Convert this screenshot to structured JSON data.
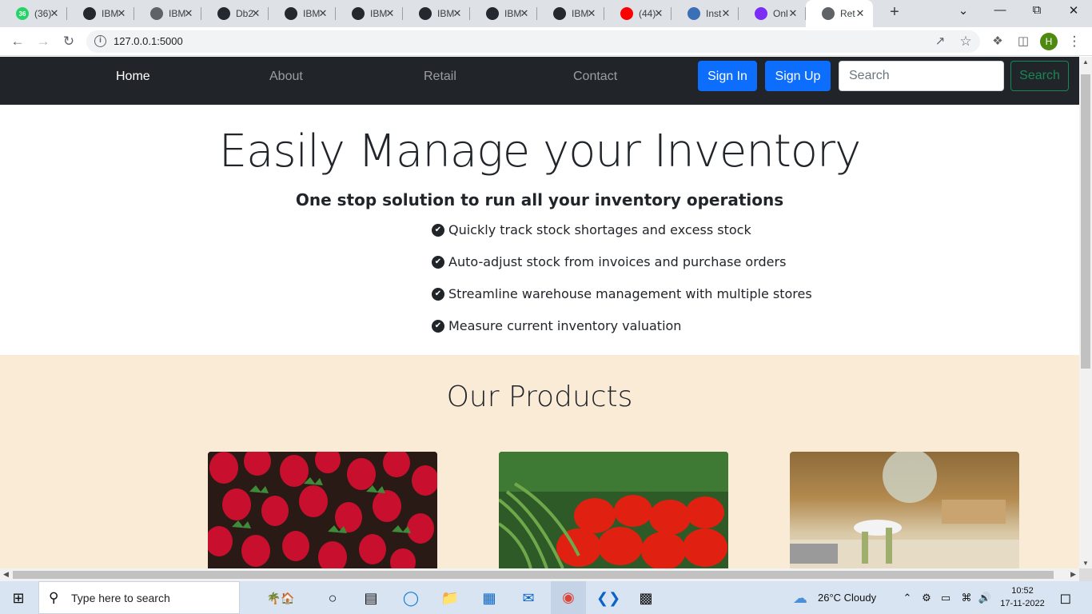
{
  "browser": {
    "tabs": [
      {
        "title": "(36)",
        "favicon": "whatsapp-icon",
        "color": "#25d366",
        "badge": "36"
      },
      {
        "title": "IBM",
        "favicon": "github-icon",
        "color": "#24292f"
      },
      {
        "title": "IBM",
        "favicon": "globe-icon",
        "color": "#5f6368"
      },
      {
        "title": "Db2",
        "favicon": "db2-icon",
        "color": "#24292f"
      },
      {
        "title": "IBM",
        "favicon": "github-icon",
        "color": "#24292f"
      },
      {
        "title": "IBM",
        "favicon": "github-icon",
        "color": "#24292f"
      },
      {
        "title": "IBM",
        "favicon": "github-icon",
        "color": "#24292f"
      },
      {
        "title": "IBM",
        "favicon": "github-icon",
        "color": "#24292f"
      },
      {
        "title": "IBM",
        "favicon": "github-icon",
        "color": "#24292f"
      },
      {
        "title": "(44)",
        "favicon": "youtube-icon",
        "color": "#ff0000"
      },
      {
        "title": "Inst",
        "favicon": "globe-icon",
        "color": "#3b6fb6"
      },
      {
        "title": "Onl",
        "favicon": "p-icon",
        "color": "#7b2cf5"
      },
      {
        "title": "Ret",
        "favicon": "globe-icon",
        "color": "#5f6368",
        "active": true
      }
    ],
    "url": "127.0.0.1:5000",
    "profile_initial": "H"
  },
  "navbar": {
    "links": [
      {
        "label": "Home",
        "active": true
      },
      {
        "label": "About"
      },
      {
        "label": "Retail"
      },
      {
        "label": "Contact"
      }
    ],
    "signin_label": "Sign In",
    "signup_label": "Sign Up",
    "search_placeholder": "Search",
    "search_button_label": "Search"
  },
  "hero": {
    "title": "Easily Manage your Inventory",
    "subtitle": "One stop solution to run all your inventory operations",
    "features": [
      "Quickly track stock shortages and excess stock",
      "Auto-adjust stock from invoices and purchase orders",
      "Streamline warehouse management with multiple stores",
      "Measure current inventory valuation"
    ]
  },
  "products": {
    "title": "Our Products",
    "background": "#faebd7",
    "cards": [
      {
        "image": "strawberries-image"
      },
      {
        "image": "tomatoes-image"
      },
      {
        "image": "kitchen-image"
      }
    ]
  },
  "taskbar": {
    "search_placeholder": "Type here to search",
    "weather": "26°C  Cloudy",
    "time": "10:52",
    "date": "17-11-2022"
  }
}
